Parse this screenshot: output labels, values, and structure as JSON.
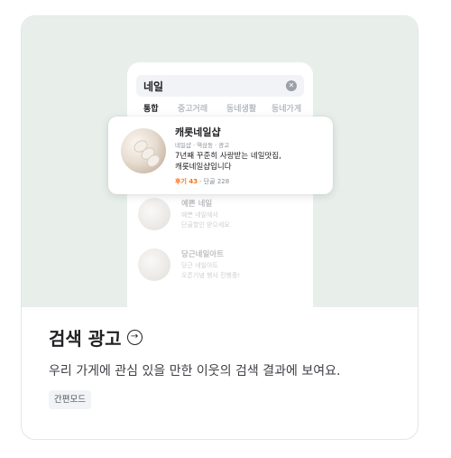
{
  "phone": {
    "search_query": "네일",
    "tabs": [
      "통합",
      "중고거래",
      "동네생활",
      "동네가게"
    ],
    "featured": {
      "name": "캐롯네일샵",
      "meta": "네일샵 · 역삼동 · 광고",
      "description_line1": "7년째 꾸준히 사랑받는 네일맛집,",
      "description_line2": "캐롯네일샵입니다",
      "review_label": "후기 43",
      "regulars": " · 단골 228"
    },
    "faded_items": [
      {
        "title": "예쁜 네일",
        "line1": "예쁜 네일에서",
        "line2": "단골할인 받으세요"
      },
      {
        "title": "당근네일아트",
        "line1": "당근 네일아트",
        "line2": "오픈기념 행사 진행중!"
      }
    ]
  },
  "card": {
    "title": "검색 광고",
    "description": "우리 가게에 관심 있을 만한 이웃의 검색 결과에 보여요.",
    "badge": "간편모드"
  },
  "colors": {
    "hero_bg": "#e8efeb",
    "accent": "#ff6f0f"
  }
}
